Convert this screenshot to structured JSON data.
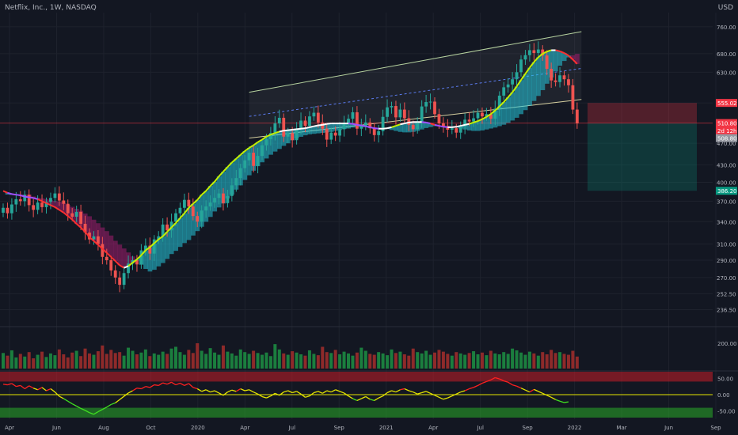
{
  "header": {
    "symbol_line": "Netflix, Inc., 1W, NASDAQ",
    "currency": "USD"
  },
  "chart_data": {
    "type": "candlestick",
    "y_axis": {
      "scale": "log",
      "min": 230,
      "max": 790,
      "ticks": [
        "760.00",
        "680.00",
        "630.00",
        "555.02",
        "470.00",
        "430.00",
        "400.00",
        "370.00",
        "340.00",
        "310.00",
        "290.00",
        "270.00",
        "252.50",
        "236.50"
      ]
    },
    "x_axis": {
      "ticks": [
        "Apr",
        "Jun",
        "Aug",
        "Oct",
        "2020",
        "Apr",
        "Jul",
        "Sep",
        "2021",
        "Apr",
        "Jul",
        "Sep",
        "2022",
        "Mar",
        "Jun",
        "Sep"
      ]
    },
    "price_labels": [
      {
        "text": "555.02",
        "value": 555.02,
        "color": "#f23645"
      },
      {
        "text": "510.80",
        "value": 510.8,
        "color": "#f23645"
      },
      {
        "text": "2d 12h",
        "value": 495,
        "color": "#f23645"
      },
      {
        "text": "508.80",
        "value": 480,
        "color": "#9598a1"
      },
      {
        "text": "386.20",
        "value": 386.2,
        "color": "#089981"
      }
    ],
    "weekly_close": [
      360,
      352,
      365,
      373,
      370,
      380,
      364,
      357,
      368,
      361,
      369,
      375,
      382,
      371,
      366,
      352,
      347,
      354,
      337,
      325,
      316,
      320,
      310,
      294,
      290,
      278,
      270,
      262,
      275,
      286,
      290,
      285,
      302,
      308,
      298,
      316,
      320,
      336,
      328,
      340,
      352,
      360,
      372,
      362,
      348,
      340,
      356,
      362,
      368,
      375,
      382,
      367,
      378,
      395,
      407,
      424,
      438,
      452,
      428,
      446,
      466,
      478,
      490,
      510,
      522,
      483,
      490,
      476,
      498,
      516,
      505,
      525,
      533,
      512,
      499,
      477,
      491,
      485,
      498,
      509,
      520,
      534,
      499,
      505,
      512,
      500,
      486,
      494,
      524,
      545,
      548,
      523,
      540,
      521,
      507,
      498,
      512,
      547,
      557,
      558,
      530,
      510,
      504,
      497,
      500,
      491,
      503,
      518,
      514,
      521,
      533,
      525,
      530,
      520,
      542,
      572,
      592,
      599,
      612,
      630,
      664,
      676,
      690,
      682,
      692,
      675,
      639,
      609,
      605,
      622,
      612,
      597,
      540,
      510
    ],
    "series": [
      {
        "name": "",
        "values": [
          386,
          383,
          381,
          380,
          379,
          377,
          376,
          375,
          373,
          370,
          367,
          364,
          361,
          357,
          353,
          348,
          343,
          337,
          332,
          326,
          319,
          314,
          309,
          304,
          299,
          294,
          289,
          284,
          281,
          283,
          287,
          291,
          296,
          302,
          306,
          311,
          316,
          320,
          326,
          332,
          338,
          345,
          352,
          360,
          366,
          372,
          380,
          386,
          394,
          401,
          410,
          418,
          426,
          434,
          441,
          448,
          455,
          461,
          466,
          472,
          477,
          483,
          487,
          490,
          493,
          495,
          496,
          497,
          498,
          499,
          500,
          502,
          504,
          506,
          507,
          509,
          510,
          510,
          510,
          510,
          510,
          509,
          507,
          506,
          504,
          502,
          500,
          499,
          499,
          500,
          502,
          505,
          508,
          510,
          512,
          513,
          513,
          513,
          512,
          510,
          507,
          505,
          503,
          502,
          502,
          503,
          505,
          507,
          509,
          512,
          515,
          519,
          524,
          530,
          538,
          547,
          557,
          568,
          580,
          594,
          610,
          626,
          642,
          657,
          670,
          680,
          686,
          690,
          690,
          687,
          682,
          675,
          664,
          652
        ]
      }
    ],
    "volume": [
      28,
      22,
      34,
      18,
      26,
      20,
      30,
      16,
      24,
      31,
      19,
      27,
      23,
      36,
      25,
      18,
      29,
      33,
      21,
      38,
      27,
      24,
      32,
      45,
      26,
      35,
      28,
      30,
      22,
      40,
      33,
      25,
      29,
      36,
      21,
      27,
      24,
      31,
      26,
      38,
      42,
      30,
      24,
      35,
      28,
      50,
      33,
      26,
      39,
      29,
      24,
      45,
      31,
      27,
      22,
      36,
      30,
      26,
      33,
      28,
      24,
      29,
      21,
      48,
      36,
      27,
      24,
      32,
      29,
      25,
      22,
      34,
      26,
      23,
      42,
      30,
      28,
      35,
      25,
      31,
      27,
      22,
      29,
      40,
      33,
      26,
      24,
      30,
      27,
      23,
      36,
      28,
      31,
      25,
      22,
      38,
      30,
      27,
      33,
      24,
      29,
      35,
      31,
      26,
      22,
      30,
      27,
      24,
      28,
      32,
      25,
      29,
      23,
      33,
      27,
      25,
      30,
      26,
      38,
      34,
      29,
      24,
      31,
      27,
      22,
      30,
      25,
      35,
      28,
      30,
      26,
      24,
      33,
      20
    ],
    "oscillator": {
      "ticks": [
        "50.00",
        "0.00",
        "-50.00"
      ],
      "min": -70,
      "max": 70,
      "values": [
        32,
        30,
        34,
        25,
        28,
        18,
        27,
        20,
        15,
        22,
        12,
        18,
        8,
        -5,
        -12,
        -20,
        -28,
        -35,
        -42,
        -48,
        -55,
        -60,
        -52,
        -45,
        -38,
        -30,
        -25,
        -15,
        -5,
        5,
        12,
        20,
        18,
        25,
        22,
        30,
        28,
        36,
        32,
        38,
        30,
        35,
        28,
        34,
        22,
        18,
        10,
        15,
        8,
        12,
        5,
        -2,
        8,
        14,
        10,
        18,
        12,
        15,
        8,
        2,
        -6,
        -10,
        -4,
        4,
        -2,
        8,
        12,
        6,
        10,
        2,
        -8,
        -4,
        6,
        10,
        4,
        12,
        8,
        15,
        10,
        5,
        -4,
        -12,
        -18,
        -12,
        -6,
        -14,
        -18,
        -10,
        -4,
        6,
        12,
        8,
        15,
        18,
        12,
        8,
        2,
        6,
        10,
        4,
        -2,
        -8,
        -14,
        -10,
        -4,
        2,
        8,
        12,
        18,
        22,
        28,
        35,
        40,
        45,
        52,
        48,
        42,
        38,
        30,
        26,
        20,
        14,
        8,
        16,
        10,
        4,
        -2,
        -8,
        -15,
        -20,
        -24,
        -22
      ]
    },
    "channel": {
      "start_index": 57,
      "end_index": 134,
      "upper": [
        580,
        745
      ],
      "middle": [
        525,
        640
      ],
      "lower": [
        480,
        563
      ]
    },
    "annotations": {
      "short_position": {
        "entry": 510.8,
        "stop": 555.02,
        "target": 386.2
      }
    }
  }
}
